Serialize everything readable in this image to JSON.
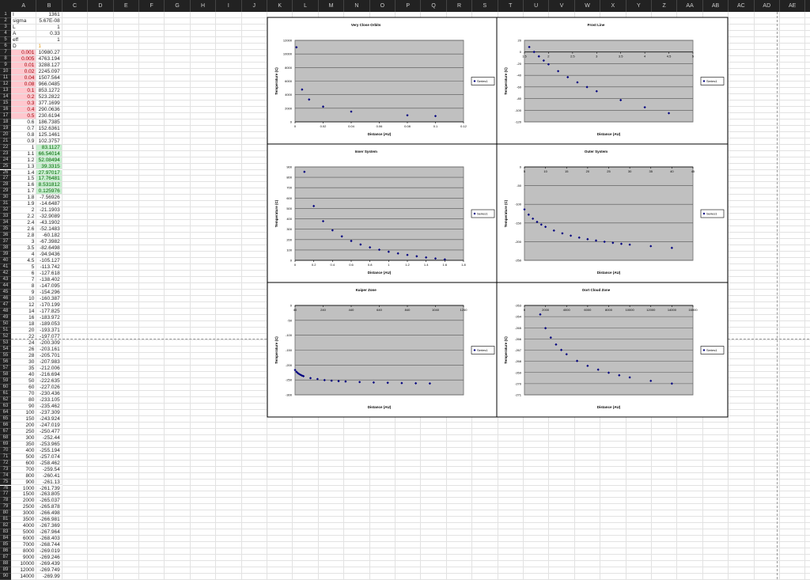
{
  "columns": [
    "A",
    "B",
    "C",
    "D",
    "E",
    "F",
    "G",
    "H",
    "I",
    "J",
    "K",
    "L",
    "M",
    "N",
    "O",
    "P",
    "Q",
    "R",
    "S",
    "T",
    "U",
    "V",
    "W",
    "X",
    "Y",
    "Z",
    "AA",
    "AB",
    "AC",
    "AD",
    "AE"
  ],
  "colors": {
    "bad_fill": "#ffc7ce",
    "bad_text": "#9c0006",
    "good_fill": "#c6efce",
    "good_text": "#006100",
    "input_text": "#e39b1a",
    "marker": "#00007f",
    "plot_bg": "#c0c0c0"
  },
  "highlights": {
    "pink_rows_col_A": "7-17",
    "green_rows_col_B": "22-29",
    "orange_cell": "B6"
  },
  "rows": [
    [
      "I",
      "1361"
    ],
    [
      "sigma",
      "5.67E-08"
    ],
    [
      "L",
      "1"
    ],
    [
      "A",
      "0.33"
    ],
    [
      "eff",
      "1"
    ],
    [
      "D",
      "1"
    ],
    [
      "0.001",
      "10980.27"
    ],
    [
      "0.005",
      "4763.194"
    ],
    [
      "0.01",
      "3288.127"
    ],
    [
      "0.02",
      "2245.097"
    ],
    [
      "0.04",
      "1507.564"
    ],
    [
      "0.08",
      "966.0485"
    ],
    [
      "0.1",
      "853.1272"
    ],
    [
      "0.2",
      "523.2822"
    ],
    [
      "0.3",
      "377.1699"
    ],
    [
      "0.4",
      "290.0636"
    ],
    [
      "0.5",
      "230.6194"
    ],
    [
      "0.6",
      "186.7385"
    ],
    [
      "0.7",
      "152.6361"
    ],
    [
      "0.8",
      "125.1461"
    ],
    [
      "0.9",
      "102.3757"
    ],
    [
      "1",
      "83.1127"
    ],
    [
      "1.1",
      "66.54014"
    ],
    [
      "1.2",
      "52.08494"
    ],
    [
      "1.3",
      "39.3315"
    ],
    [
      "1.4",
      "27.97017"
    ],
    [
      "1.5",
      "17.76481"
    ],
    [
      "1.6",
      "8.531812"
    ],
    [
      "1.7",
      "0.125976"
    ],
    [
      "1.8",
      "-7.56926"
    ],
    [
      "1.9",
      "-14.6487"
    ],
    [
      "2",
      "-21.1903"
    ],
    [
      "2.2",
      "-32.9089"
    ],
    [
      "2.4",
      "-43.1902"
    ],
    [
      "2.6",
      "-52.1483"
    ],
    [
      "2.8",
      "-60.182"
    ],
    [
      "3",
      "-67.3982"
    ],
    [
      "3.5",
      "-82.6498"
    ],
    [
      "4",
      "-94.9436"
    ],
    [
      "4.5",
      "-105.127"
    ],
    [
      "5",
      "-113.742"
    ],
    [
      "6",
      "-127.618"
    ],
    [
      "7",
      "-138.402"
    ],
    [
      "8",
      "-147.095"
    ],
    [
      "9",
      "-154.296"
    ],
    [
      "10",
      "-160.387"
    ],
    [
      "12",
      "-170.199"
    ],
    [
      "14",
      "-177.825"
    ],
    [
      "16",
      "-183.972"
    ],
    [
      "18",
      "-189.053"
    ],
    [
      "20",
      "-193.371"
    ],
    [
      "22",
      "-197.077"
    ],
    [
      "24",
      "-200.309"
    ],
    [
      "26",
      "-203.161"
    ],
    [
      "28",
      "-205.701"
    ],
    [
      "30",
      "-207.983"
    ],
    [
      "35",
      "-212.006"
    ],
    [
      "40",
      "-216.694"
    ],
    [
      "50",
      "-222.635"
    ],
    [
      "60",
      "-227.026"
    ],
    [
      "70",
      "-230.436"
    ],
    [
      "80",
      "-233.105"
    ],
    [
      "90",
      "-235.462"
    ],
    [
      "100",
      "-237.309"
    ],
    [
      "150",
      "-243.924"
    ],
    [
      "200",
      "-247.019"
    ],
    [
      "250",
      "-250.477"
    ],
    [
      "300",
      "-252.44"
    ],
    [
      "350",
      "-253.965"
    ],
    [
      "400",
      "-255.194"
    ],
    [
      "500",
      "-257.074"
    ],
    [
      "600",
      "-258.462"
    ],
    [
      "700",
      "-259.54"
    ],
    [
      "800",
      "-260.41"
    ],
    [
      "900",
      "-261.13"
    ],
    [
      "1000",
      "-261.739"
    ],
    [
      "1500",
      "-263.805"
    ],
    [
      "2000",
      "-265.037"
    ],
    [
      "2500",
      "-265.878"
    ],
    [
      "3000",
      "-266.498"
    ],
    [
      "3500",
      "-266.981"
    ],
    [
      "4000",
      "-267.369"
    ],
    [
      "5000",
      "-267.964"
    ],
    [
      "6000",
      "-268.403"
    ],
    [
      "7000",
      "-268.744"
    ],
    [
      "8000",
      "-269.019"
    ],
    [
      "9000",
      "-269.246"
    ],
    [
      "10000",
      "-269.439"
    ],
    [
      "12000",
      "-269.749"
    ],
    [
      "14000",
      "-269.99"
    ]
  ],
  "chart_data": [
    {
      "type": "scatter",
      "title": "Very Close Orbits",
      "xlabel": "Distance (AU)",
      "ylabel": "Temperature (C)",
      "legend": "right",
      "grid": true,
      "xlim": [
        0,
        0.12
      ],
      "xstep": 0.02,
      "ylim": [
        0,
        12000
      ],
      "ystep": 2000,
      "xticks": [
        "0",
        "0.02",
        "0.04",
        "0.06",
        "0.08",
        "0.1",
        "0.12"
      ],
      "yticks": [
        "0",
        "2000",
        "4000",
        "6000",
        "8000",
        "10000",
        "12000"
      ],
      "series": [
        {
          "name": "Series1",
          "x": [
            0.001,
            0.005,
            0.01,
            0.02,
            0.04,
            0.08,
            0.1
          ],
          "y": [
            10980.27,
            4763.194,
            3288.127,
            2245.097,
            1507.564,
            966.0485,
            853.1272
          ]
        }
      ]
    },
    {
      "type": "scatter",
      "title": "Frost Line",
      "xlabel": "Distance (AU)",
      "ylabel": "Temperature (C)",
      "legend": "right",
      "grid": true,
      "xlim": [
        1.5,
        5
      ],
      "xstep": 0.5,
      "ylim": [
        -120,
        20
      ],
      "ystep": 20,
      "xticks": [
        "1.5",
        "2",
        "2.5",
        "3",
        "3.5",
        "4",
        "4.5",
        "5"
      ],
      "yticks": [
        "-120",
        "-100",
        "-80",
        "-60",
        "-40",
        "-20",
        "0",
        "20"
      ],
      "series": [
        {
          "name": "Series1",
          "x": [
            1.6,
            1.7,
            1.8,
            1.9,
            2,
            2.2,
            2.4,
            2.6,
            2.8,
            3,
            3.5,
            4,
            4.5
          ],
          "y": [
            8.531812,
            0.125976,
            -7.56926,
            -14.6487,
            -21.1903,
            -32.9089,
            -43.1902,
            -52.1483,
            -60.182,
            -67.3982,
            -82.6498,
            -94.9436,
            -105.127
          ]
        }
      ]
    },
    {
      "type": "scatter",
      "title": "Inner System",
      "xlabel": "Distance (AU)",
      "ylabel": "Temperature (C)",
      "legend": "right",
      "grid": true,
      "xlim": [
        0,
        1.8
      ],
      "xstep": 0.2,
      "ylim": [
        0,
        900
      ],
      "ystep": 100,
      "xticks": [
        "0",
        "0.2",
        "0.4",
        "0.6",
        "0.8",
        "1",
        "1.2",
        "1.4",
        "1.6",
        "1.8"
      ],
      "yticks": [
        "0",
        "100",
        "200",
        "300",
        "400",
        "500",
        "600",
        "700",
        "800",
        "900"
      ],
      "series": [
        {
          "name": "Series1",
          "x": [
            0.1,
            0.2,
            0.3,
            0.4,
            0.5,
            0.6,
            0.7,
            0.8,
            0.9,
            1,
            1.1,
            1.2,
            1.3,
            1.4,
            1.5,
            1.6
          ],
          "y": [
            853.1272,
            523.2822,
            377.1699,
            290.0636,
            230.6194,
            186.7385,
            152.6361,
            125.1461,
            102.3757,
            83.1127,
            66.54014,
            52.08494,
            39.3315,
            27.97017,
            17.76481,
            8.531812
          ]
        }
      ]
    },
    {
      "type": "scatter",
      "title": "Outer System",
      "xlabel": "Distance (AU)",
      "ylabel": "Temperature (C)",
      "legend": "right",
      "grid": true,
      "xlim": [
        5,
        45
      ],
      "xstep": 5,
      "ylim": [
        -250,
        0
      ],
      "ystep": 50,
      "xticks": [
        "5",
        "10",
        "15",
        "20",
        "25",
        "30",
        "35",
        "40",
        "45"
      ],
      "yticks": [
        "-250",
        "-200",
        "-150",
        "-100",
        "-50",
        "0"
      ],
      "series": [
        {
          "name": "Series1",
          "x": [
            5,
            6,
            7,
            8,
            9,
            10,
            12,
            14,
            16,
            18,
            20,
            22,
            24,
            26,
            28,
            30,
            35,
            40
          ],
          "y": [
            -113.742,
            -127.618,
            -138.402,
            -147.095,
            -154.296,
            -160.387,
            -170.199,
            -177.825,
            -183.972,
            -189.053,
            -193.371,
            -197.077,
            -200.309,
            -203.161,
            -205.701,
            -207.983,
            -212.006,
            -216.694
          ]
        }
      ]
    },
    {
      "type": "scatter",
      "title": "Kuiper Zone",
      "xlabel": "Distance (AU)",
      "ylabel": "Temperature (C)",
      "legend": "right",
      "grid": true,
      "xlim": [
        40,
        1240
      ],
      "xstep": 200,
      "ylim": [
        -300,
        0
      ],
      "ystep": 50,
      "xticks": [
        "40",
        "240",
        "440",
        "640",
        "840",
        "1040",
        "1240"
      ],
      "yticks": [
        "-300",
        "-250",
        "-200",
        "-150",
        "-100",
        "-50",
        "0"
      ],
      "series": [
        {
          "name": "Series1",
          "x": [
            40,
            50,
            60,
            70,
            80,
            90,
            100,
            150,
            200,
            250,
            300,
            350,
            400,
            500,
            600,
            700,
            800,
            900,
            1000
          ],
          "y": [
            -216.694,
            -222.635,
            -227.026,
            -230.436,
            -233.105,
            -235.462,
            -237.309,
            -243.924,
            -247.019,
            -250.477,
            -252.44,
            -253.965,
            -255.194,
            -257.074,
            -258.462,
            -259.54,
            -260.41,
            -261.13,
            -261.739
          ]
        }
      ]
    },
    {
      "type": "scatter",
      "title": "Oort Cloud Zone",
      "xlabel": "Distance (AU)",
      "ylabel": "Temperature (C)",
      "legend": "right",
      "grid": true,
      "xlim": [
        0,
        16000
      ],
      "xstep": 2000,
      "ylim": [
        -271,
        -263
      ],
      "ystep": 1,
      "xticks": [
        "0",
        "2000",
        "4000",
        "6000",
        "8000",
        "10000",
        "12000",
        "14000",
        "16000"
      ],
      "yticks": [
        "-271",
        "-270",
        "-269",
        "-268",
        "-267",
        "-266",
        "-265",
        "-264",
        "-263"
      ],
      "series": [
        {
          "name": "Series1",
          "x": [
            1500,
            2000,
            2500,
            3000,
            3500,
            4000,
            5000,
            6000,
            7000,
            8000,
            9000,
            10000,
            12000,
            14000
          ],
          "y": [
            -263.805,
            -265.037,
            -265.878,
            -266.498,
            -266.981,
            -267.369,
            -267.964,
            -268.403,
            -268.744,
            -269.019,
            -269.246,
            -269.439,
            -269.749,
            -269.99
          ]
        }
      ]
    }
  ]
}
